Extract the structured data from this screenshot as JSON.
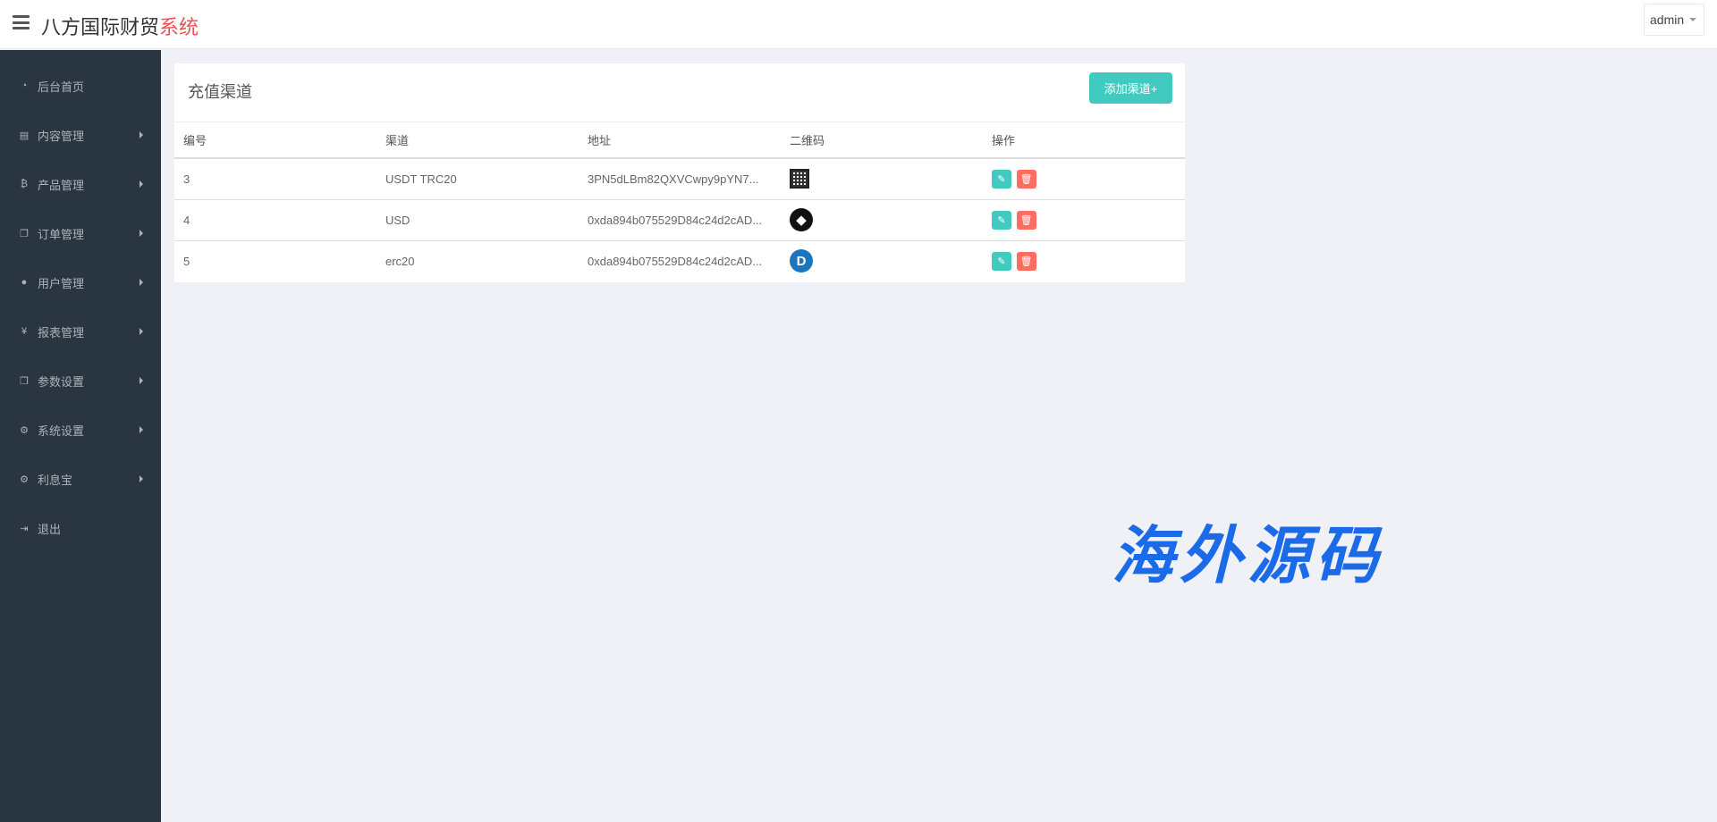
{
  "header": {
    "brand_main": "八方国际财贸",
    "brand_accent": "系统",
    "user": "admin"
  },
  "sidebar": {
    "items": [
      {
        "label": "后台首页",
        "icon": "dashboard-icon",
        "glyph": "◔",
        "has_arrow": false
      },
      {
        "label": "内容管理",
        "icon": "book-icon",
        "glyph": "▤",
        "has_arrow": true
      },
      {
        "label": "产品管理",
        "icon": "bitcoin-icon",
        "glyph": "₿",
        "has_arrow": true
      },
      {
        "label": "订单管理",
        "icon": "copy-icon",
        "glyph": "❐",
        "has_arrow": true
      },
      {
        "label": "用户管理",
        "icon": "user-icon",
        "glyph": "●",
        "has_arrow": true
      },
      {
        "label": "报表管理",
        "icon": "yen-icon",
        "glyph": "¥",
        "has_arrow": true
      },
      {
        "label": "参数设置",
        "icon": "copy-icon",
        "glyph": "❐",
        "has_arrow": true
      },
      {
        "label": "系统设置",
        "icon": "cogs-icon",
        "glyph": "⚙",
        "has_arrow": true
      },
      {
        "label": "利息宝",
        "icon": "cogs-icon",
        "glyph": "⚙",
        "has_arrow": true
      },
      {
        "label": "退出",
        "icon": "sign-out-icon",
        "glyph": "⇥",
        "has_arrow": false
      }
    ]
  },
  "panel": {
    "title": "充值渠道",
    "add_label": "添加渠道+"
  },
  "table": {
    "headers": [
      "编号",
      "渠道",
      "地址",
      "二维码",
      "操作"
    ],
    "rows": [
      {
        "id": "3",
        "channel": "USDT TRC20",
        "address": "3PN5dLBm82QXVCwpy9pYN7...",
        "qr": "qr-code-icon"
      },
      {
        "id": "4",
        "channel": "USD",
        "address": "0xda894b075529D84c24d2cAD...",
        "qr": "ethereum-icon"
      },
      {
        "id": "5",
        "channel": "erc20",
        "address": "0xda894b075529D84c24d2cAD...",
        "qr": "dash-icon"
      }
    ]
  },
  "watermark": "海外源码",
  "colors": {
    "sidebar_bg": "#2a3542",
    "accent": "#41cac0",
    "danger": "#ff6c60",
    "brand_accent": "#f05050"
  }
}
